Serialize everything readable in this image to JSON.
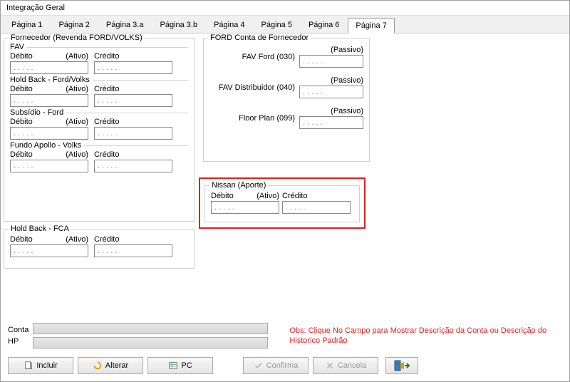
{
  "window": {
    "title": "Integração Geral"
  },
  "tabs": [
    "Página 1",
    "Página 2",
    "Página 3.a",
    "Página 3.b",
    "Página 4",
    "Página 5",
    "Página 6",
    "Página 7"
  ],
  "activeTab": 7,
  "labels": {
    "debito": "Débito",
    "credito": "Crédito",
    "ativo": "(Ativo)",
    "passivo": "(Passivo)"
  },
  "leftGroup": {
    "title": "Fornecedor (Revenda FORD/VOLKS)",
    "sections": [
      {
        "title": "FAV",
        "debito": ". . . . .",
        "credito": ". . . . ."
      },
      {
        "title": "Hold Back - Ford/Volks",
        "debito": ". . . . .",
        "credito": ". . . . ."
      },
      {
        "title": "Subsídio - Ford",
        "debito": ". . . . .",
        "credito": ". . . . ."
      },
      {
        "title": "Fundo Apollo - Volks",
        "debito": ". . . . .",
        "credito": ". . . . ."
      }
    ]
  },
  "holdBackFca": {
    "title": "Hold Back - FCA",
    "debito": ". . . . .",
    "credito": ". . . . ."
  },
  "rightGroup": {
    "title": "FORD Conta de Fornecedor",
    "rows": [
      {
        "label": "FAV Ford (030)",
        "value": ". . . . ."
      },
      {
        "label": "FAV Distribuidor (040)",
        "value": ". . . . ."
      },
      {
        "label": "Floor Plan (099)",
        "value": ". . . . ."
      }
    ]
  },
  "nissan": {
    "title": "Nissan (Aporte)",
    "debito": ". . . . .",
    "credito": ". . . . ."
  },
  "footer": {
    "contaLabel": "Conta",
    "hpLabel": "HP",
    "note": "Obs: Clique No Campo para Mostrar Descrição da Conta ou Descrição do Historico Padrão"
  },
  "buttons": {
    "incluir": "Incluir",
    "alterar": "Alterar",
    "pc": "PC",
    "confirma": "Confirma",
    "cancela": "Cancela"
  }
}
